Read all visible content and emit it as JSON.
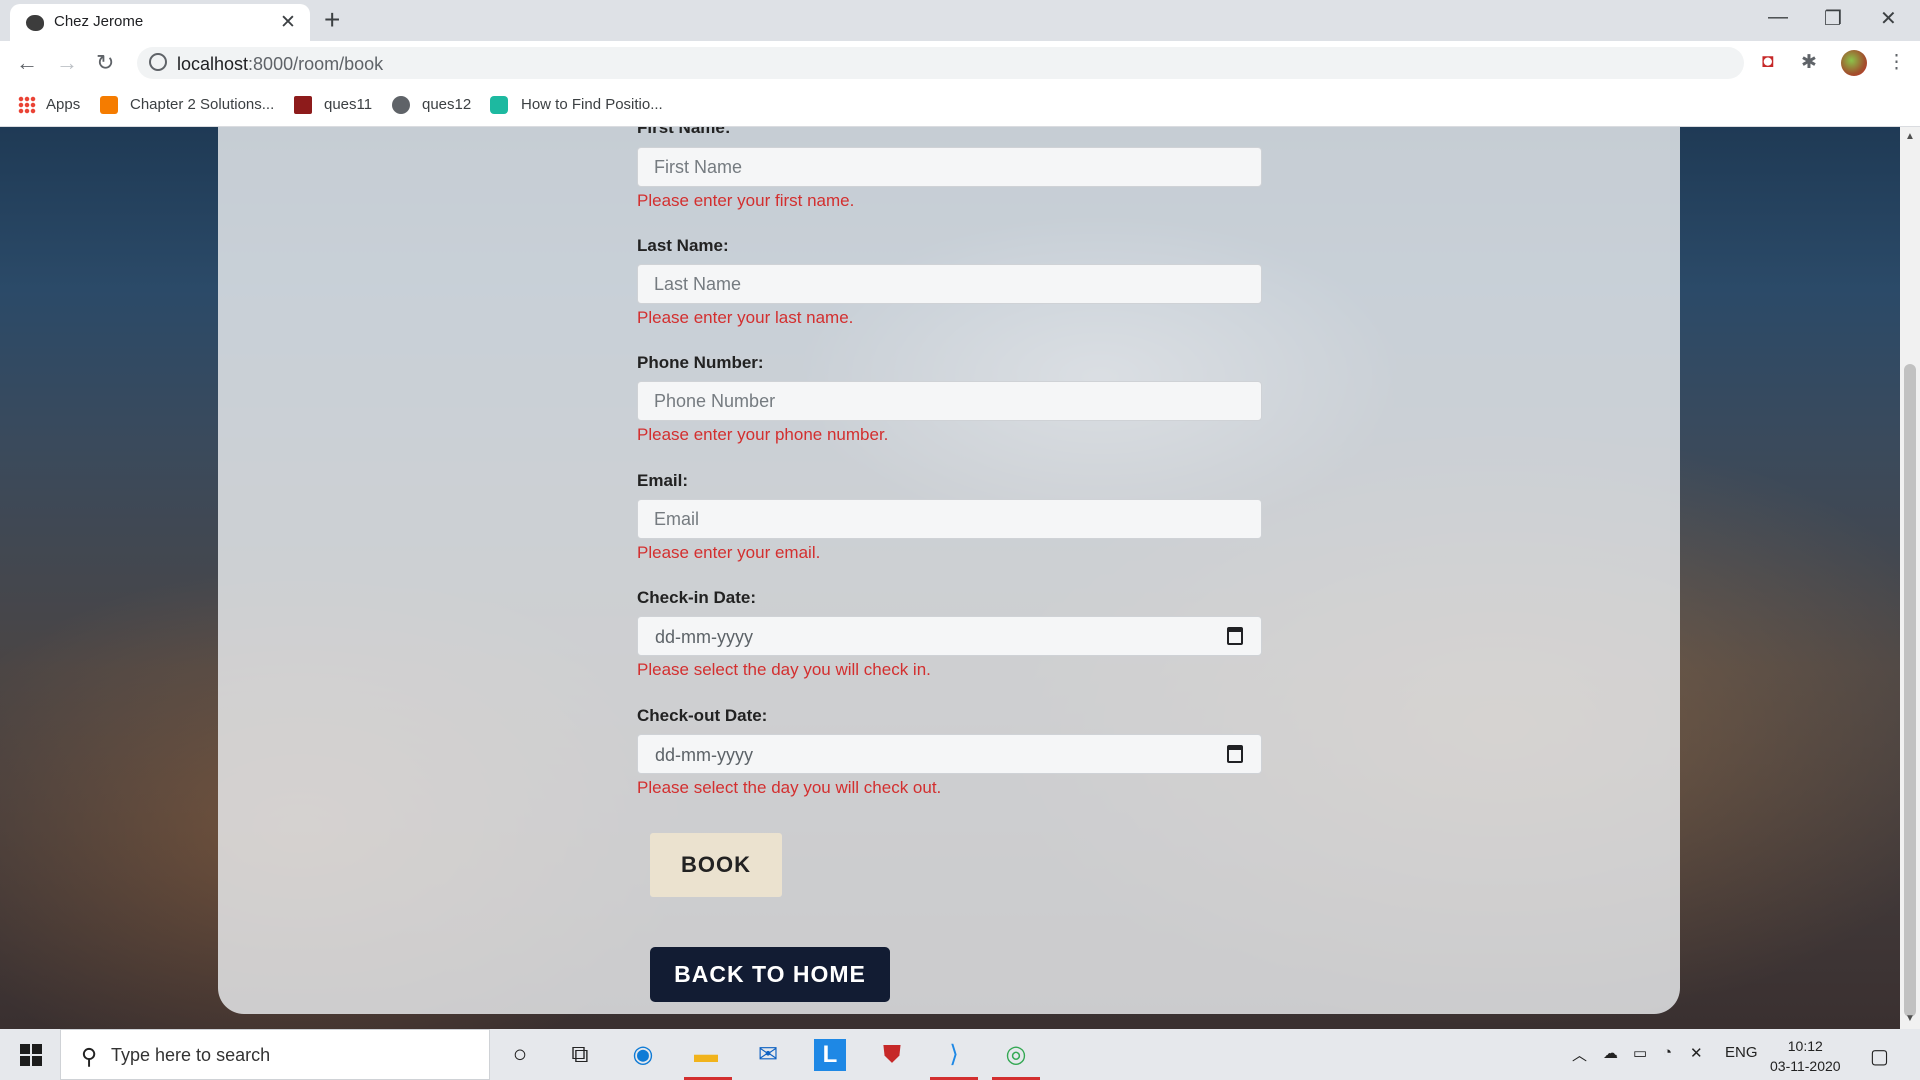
{
  "browser": {
    "tab_title": "Chez Jerome",
    "url_host": "localhost",
    "url_path": ":8000/room/book",
    "bookmarks": [
      {
        "label": "Apps",
        "icon": "apps-grid-icon"
      },
      {
        "label": "Chapter 2 Solutions...",
        "icon": "chegg-icon"
      },
      {
        "label": "ques11",
        "icon": "university-icon"
      },
      {
        "label": "ques12",
        "icon": "globe-icon"
      },
      {
        "label": "How to Find Positio...",
        "icon": "hexagon-icon"
      }
    ]
  },
  "form": {
    "first_name_label": "First Name:",
    "first_name_placeholder": "First Name",
    "first_name_error": "Please enter your first name.",
    "last_name_label": "Last Name:",
    "last_name_placeholder": "Last Name",
    "last_name_error": "Please enter your last name.",
    "phone_label": "Phone Number:",
    "phone_placeholder": "Phone Number",
    "phone_error": "Please enter your phone number.",
    "email_label": "Email:",
    "email_placeholder": "Email",
    "email_error": "Please enter your email.",
    "checkin_label": "Check-in Date:",
    "checkin_value": "dd-mm-yyyy",
    "checkin_error": "Please select the day you will check in.",
    "checkout_label": "Check-out Date:",
    "checkout_value": "dd-mm-yyyy",
    "checkout_error": "Please select the day you will check out.",
    "book_label": "BOOK",
    "back_home_label": "BACK TO HOME",
    "error_color": "#d32f2f"
  },
  "taskbar": {
    "search_placeholder": "Type here to search",
    "language": "ENG",
    "time": "10:12",
    "date": "03-11-2020"
  }
}
